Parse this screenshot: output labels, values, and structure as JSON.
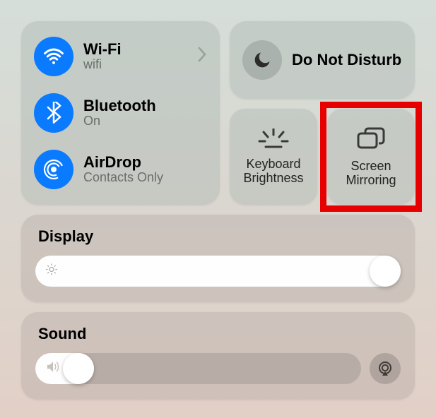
{
  "connectivity": {
    "wifi": {
      "title": "Wi-Fi",
      "sub": "wifi"
    },
    "bluetooth": {
      "title": "Bluetooth",
      "sub": "On"
    },
    "airdrop": {
      "title": "AirDrop",
      "sub": "Contacts Only"
    }
  },
  "dnd": {
    "label": "Do Not\nDisturb"
  },
  "smallButtons": {
    "keyboard": "Keyboard\nBrightness",
    "screenMirroring": "Screen\nMirroring"
  },
  "display": {
    "title": "Display",
    "value_pct": 100
  },
  "sound": {
    "title": "Sound",
    "value_pct": 18
  },
  "colors": {
    "accent_blue": "#0a7aff",
    "highlight_red": "#e60000"
  }
}
